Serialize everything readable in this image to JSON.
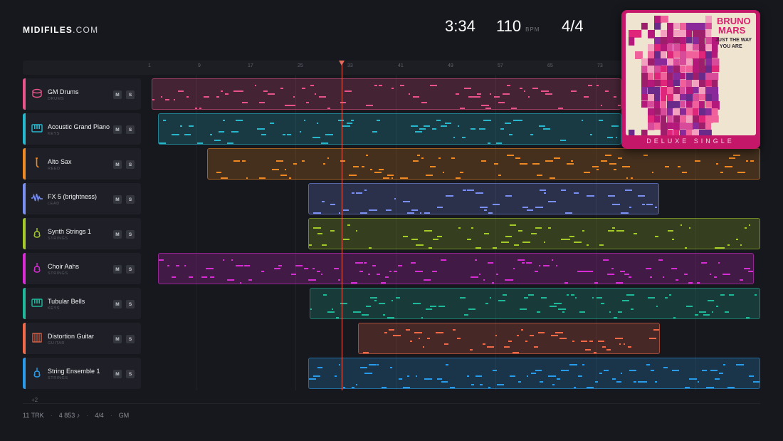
{
  "brand": {
    "name_bold": "MIDIFILES",
    "name_light": ".COM"
  },
  "stats": {
    "time": "3:34",
    "bpm": "110",
    "bpm_unit": "BPM",
    "time_signature": "4/4"
  },
  "ruler": {
    "ticks": [
      "1",
      "9",
      "17",
      "25",
      "33",
      "41",
      "49",
      "57",
      "65",
      "73"
    ]
  },
  "colors": {
    "background": "#17181d",
    "playhead": "#e86a5d"
  },
  "tracks": [
    {
      "name": "GM Drums",
      "category": "DRUMS",
      "color": "#e8548a",
      "icon": "drum-icon",
      "mute": "M",
      "solo": "S"
    },
    {
      "name": "Acoustic Grand Piano",
      "category": "KEYS",
      "color": "#26b8cf",
      "icon": "piano-icon",
      "mute": "M",
      "solo": "S"
    },
    {
      "name": "Alto Sax",
      "category": "REED",
      "color": "#ee8a25",
      "icon": "sax-icon",
      "mute": "M",
      "solo": "S"
    },
    {
      "name": "FX 5 (brightness)",
      "category": "LEAD",
      "color": "#7a8ff0",
      "icon": "waveform-icon",
      "mute": "M",
      "solo": "S"
    },
    {
      "name": "Synth Strings 1",
      "category": "STRINGS",
      "color": "#a3c92a",
      "icon": "violin-icon",
      "mute": "M",
      "solo": "S"
    },
    {
      "name": "Choir Aahs",
      "category": "STRINGS",
      "color": "#d92bd6",
      "icon": "violin-icon",
      "mute": "M",
      "solo": "S"
    },
    {
      "name": "Tubular Bells",
      "category": "KEYS",
      "color": "#1fb89a",
      "icon": "piano-icon",
      "mute": "M",
      "solo": "S"
    },
    {
      "name": "Distortion Guitar",
      "category": "GUITAR",
      "color": "#f06a4a",
      "icon": "guitar-icon",
      "mute": "M",
      "solo": "S"
    },
    {
      "name": "String Ensemble 1",
      "category": "STRINGS",
      "color": "#2a9be8",
      "icon": "violin-icon",
      "mute": "M",
      "solo": "S"
    }
  ],
  "more_tracks": "+2",
  "footer": {
    "tracks": "11 TRK",
    "notes": "4 853 ♪",
    "time_signature": "4/4",
    "standard": "GM",
    "sep": "·"
  },
  "album": {
    "artist_line1": "BRUNO",
    "artist_line2": "MARS",
    "title_line1": "JUST THE WAY",
    "title_line2": "YOU ARE",
    "edition": "DELUXE SINGLE"
  }
}
